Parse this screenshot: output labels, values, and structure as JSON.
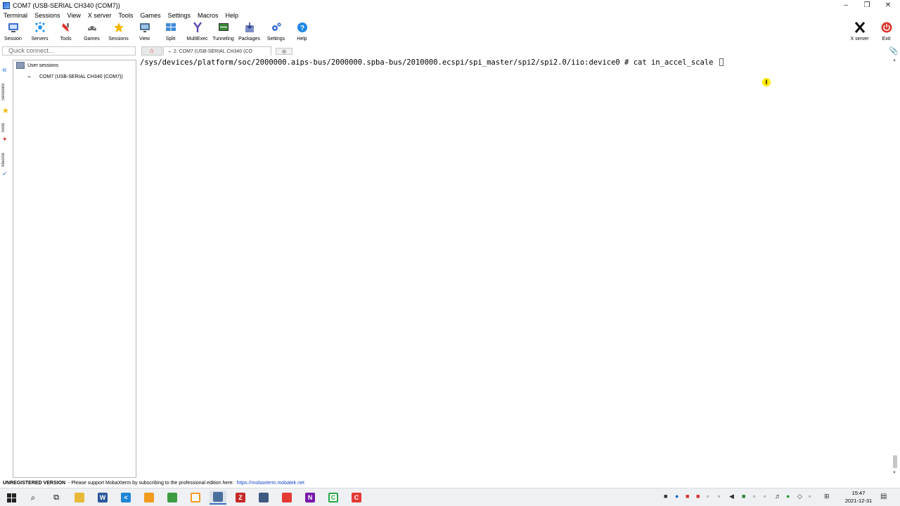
{
  "window": {
    "title": "COM7  (USB-SERIAL CH340 (COM7))"
  },
  "menu": [
    "Terminal",
    "Sessions",
    "View",
    "X server",
    "Tools",
    "Games",
    "Settings",
    "Macros",
    "Help"
  ],
  "toolbar": {
    "buttons": [
      {
        "label": "Session",
        "icon": "session-icon",
        "color": "#3a6fcf"
      },
      {
        "label": "Servers",
        "icon": "servers-icon",
        "color": "#2196f3"
      },
      {
        "label": "Tools",
        "icon": "tools-icon",
        "color": "#d9372c"
      },
      {
        "label": "Games",
        "icon": "games-icon",
        "color": "#6c6c6c"
      },
      {
        "label": "Sessions",
        "icon": "star-icon",
        "color": "#f2b600"
      },
      {
        "label": "View",
        "icon": "view-icon",
        "color": "#4d6f93"
      },
      {
        "label": "Split",
        "icon": "split-icon",
        "color": "#3e8ad6"
      },
      {
        "label": "MultiExec",
        "icon": "multiexec-icon",
        "color": "#5b4bb0"
      },
      {
        "label": "Tunneling",
        "icon": "tunneling-icon",
        "color": "#3b8a3b"
      },
      {
        "label": "Packages",
        "icon": "packages-icon",
        "color": "#7a8cc4"
      },
      {
        "label": "Settings",
        "icon": "settings-icon",
        "color": "#3a6fcf"
      },
      {
        "label": "Help",
        "icon": "help-icon",
        "color": "#1e88e5"
      }
    ],
    "xserver_label": "X server",
    "exit_label": "Exit"
  },
  "quick_connect": {
    "placeholder": "Quick connect..."
  },
  "side_tabs": [
    "Sessions",
    "Tools",
    "Macros"
  ],
  "sessions_panel": {
    "root_label": "User sessions",
    "items": [
      "COM7  (USB-SERIAL CH340 (COM7))"
    ]
  },
  "tabs": {
    "active_tab_label": "2. COM7  (USB-SERIAL CH340 (CO"
  },
  "terminal": {
    "line": "/sys/devices/platform/soc/2000000.aips-bus/2000000.spba-bus/2010000.ecspi/spi_master/spi2/spi2.0/iio:device0 # cat in_accel_scale "
  },
  "statusbar": {
    "unregistered": "UNREGISTERED VERSION",
    "message": " -  Please support MobaXterm by subscribing to the professional edition here:",
    "link": "https://mobaxterm.mobatek.net"
  },
  "taskbar": {
    "time": "15:47",
    "date": "2021-12-31"
  },
  "colors": {
    "accent": "#2a6fd6",
    "link": "#1a47c4",
    "exit": "#d9372c",
    "highlight": "#ffea00"
  }
}
